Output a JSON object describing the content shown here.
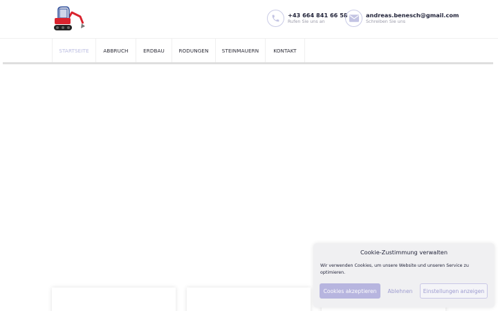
{
  "header": {
    "logo_icon": "mini-excavator-logo",
    "phone": {
      "icon": "phone-icon",
      "number": "+43 664 841 66 58",
      "caption": "Rufen Sie uns an"
    },
    "email": {
      "icon": "envelope-icon",
      "address": "andreas.benesch@gmail.com",
      "caption": "Schreiben Sie uns"
    }
  },
  "nav": {
    "items": [
      {
        "label": "STARTSEITE",
        "active": true
      },
      {
        "label": "ABBRUCH"
      },
      {
        "label": "ERDBAU"
      },
      {
        "label": "RODUNGEN"
      },
      {
        "label": "STEINMAUERN"
      },
      {
        "label": "KONTAKT"
      }
    ]
  },
  "cookie_banner": {
    "title": "Cookie-Zustimmung verwalten",
    "text": "Wir verwenden Cookies, um unsere Website und unseren Service zu optimieren.",
    "accept_label": "Cookies akzeptieren",
    "deny_label": "Ablehnen",
    "settings_label": "Einstellungen anzeigen"
  },
  "colors": {
    "accent": "#b7b5df",
    "active_nav": "#b9bbe0",
    "logo_red": "#d9232e"
  }
}
